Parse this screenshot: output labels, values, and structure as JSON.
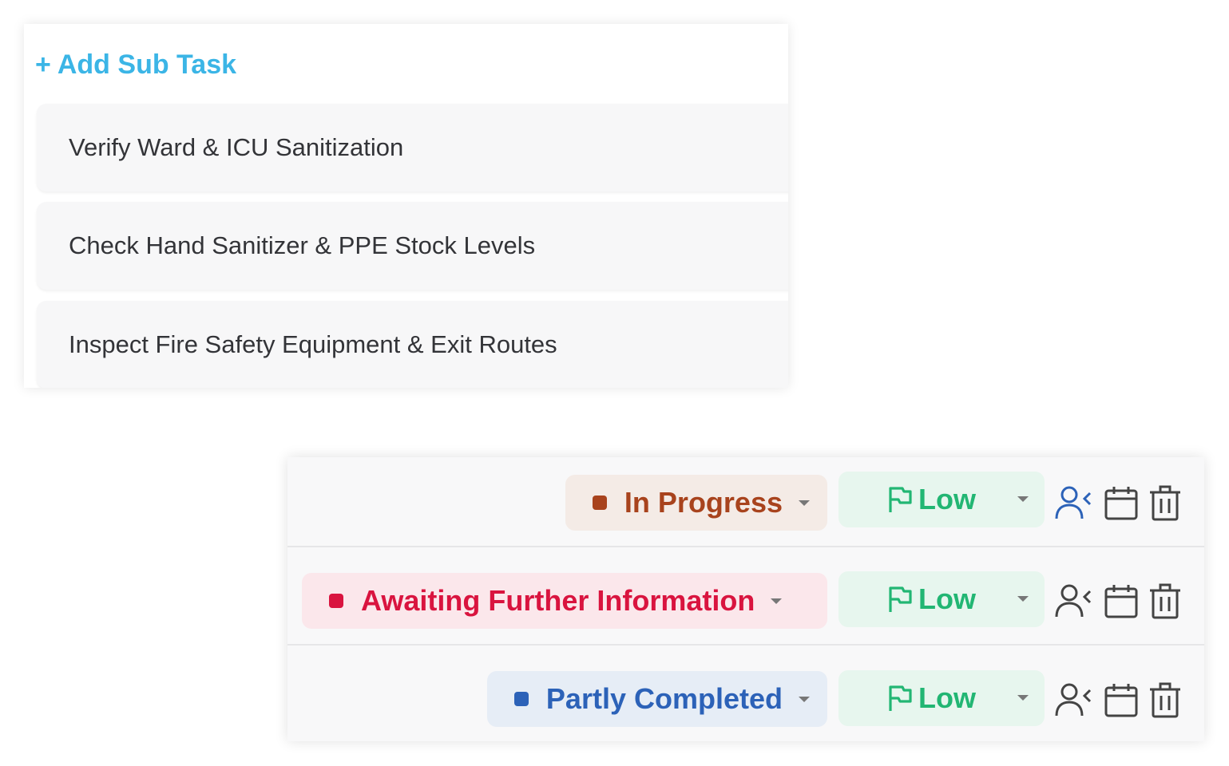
{
  "subtasks": {
    "add_label": "Add Sub Task",
    "add_icon": "plus-icon",
    "items": [
      {
        "title": "Verify Ward & ICU Sanitization"
      },
      {
        "title": "Check Hand Sanitizer & PPE Stock Levels"
      },
      {
        "title": "Inspect Fire Safety Equipment & Exit Routes"
      }
    ]
  },
  "task_rows": [
    {
      "status": "In Progress",
      "status_color": "#a8431d",
      "priority": "Low",
      "priority_color": "#22b673",
      "assign_icon_color": "#2c62b8"
    },
    {
      "status": "Awaiting Further Information",
      "status_color": "#d9143f",
      "priority": "Low",
      "priority_color": "#22b673",
      "assign_icon_color": "#444444"
    },
    {
      "status": "Partly Completed",
      "status_color": "#2c62b8",
      "priority": "Low",
      "priority_color": "#22b673",
      "assign_icon_color": "#444444"
    }
  ],
  "icons": {
    "priority": "flag-icon",
    "assign": "assign-user-icon",
    "date": "calendar-icon",
    "delete": "trash-icon",
    "dropdown": "chevron-down-icon"
  },
  "colors": {
    "accent": "#3bb5e6"
  }
}
